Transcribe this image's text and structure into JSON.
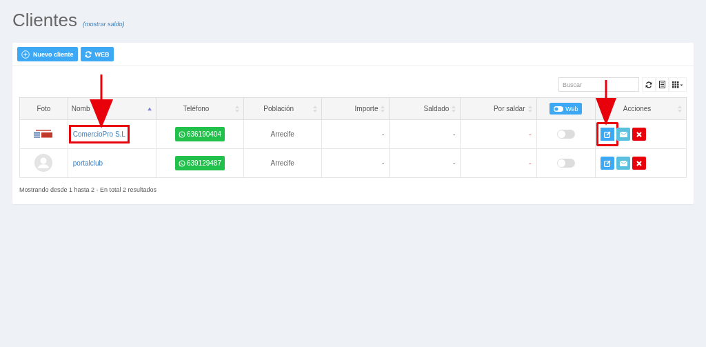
{
  "page": {
    "title": "Clientes",
    "balance_link": "(mostrar saldo)"
  },
  "toolbar": {
    "buttons": [
      {
        "kind": "add",
        "label": "Nuevo cliente"
      },
      {
        "kind": "sync",
        "label": "WEB"
      }
    ]
  },
  "search": {
    "placeholder": "Buscar"
  },
  "table": {
    "columns": [
      {
        "label": "Foto",
        "kind": "image",
        "sortable": false
      },
      {
        "label": "Nomb",
        "kind": "link",
        "sortable": true,
        "sorted": true
      },
      {
        "label": "Teléfono",
        "kind": "button",
        "sortable": true,
        "sorted": false
      },
      {
        "label": "Población",
        "kind": "text",
        "sortable": true,
        "sorted": false
      },
      {
        "label": "Importe",
        "kind": "number",
        "sortable": true,
        "sorted": false
      },
      {
        "label": "Saldado",
        "kind": "number",
        "sortable": true,
        "sorted": false
      },
      {
        "label": "Por saldar",
        "kind": "number",
        "sortable": true,
        "sorted": false
      },
      {
        "label": "Web",
        "kind": "toggle",
        "sortable": false
      },
      {
        "label": "Acciones",
        "kind": "actions",
        "sortable": true,
        "sorted": false
      }
    ],
    "rows": [
      {
        "photo": {
          "kind": "logo"
        },
        "name": "ComercioPro S.L",
        "name_highlighted": true,
        "phone": "636190404",
        "town": "Arrecife",
        "amount": "-",
        "paid": "-",
        "due": "-",
        "web_on": false,
        "edit_highlighted": true
      },
      {
        "photo": {
          "kind": "avatar"
        },
        "name": "portalclub",
        "name_highlighted": false,
        "phone": "639129487",
        "town": "Arrecife",
        "amount": "-",
        "paid": "-",
        "due": "-",
        "web_on": false,
        "edit_highlighted": false
      }
    ]
  },
  "footer": "Mostrando desde 1 hasta 2 - En total 2 resultados"
}
